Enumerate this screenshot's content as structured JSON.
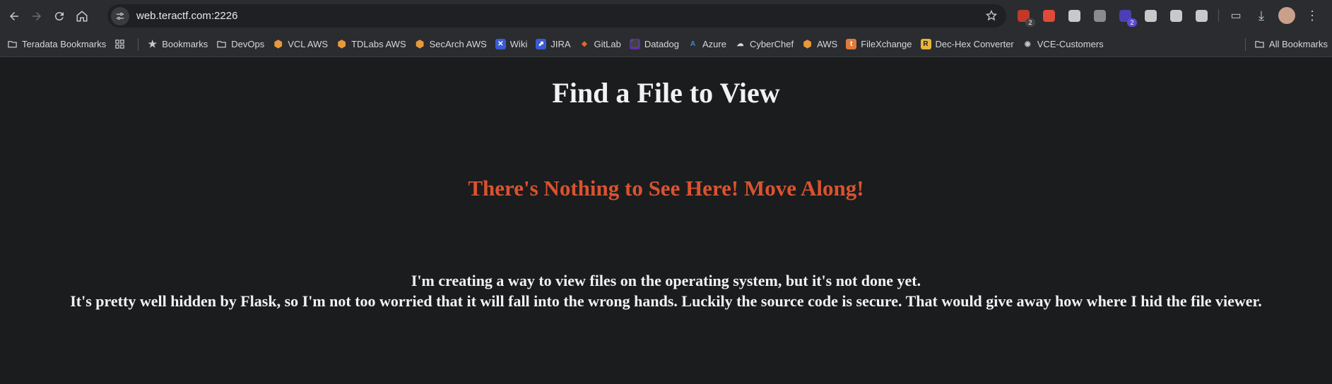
{
  "browser": {
    "url": "web.teractf.com:2226",
    "extensions": [
      {
        "name": "ext-badge-2-icon",
        "badge": "2",
        "color": "#c0392b"
      },
      {
        "name": "hand-stop-icon",
        "badge": "",
        "color": "#e04a3a"
      },
      {
        "name": "grammarly-icon",
        "badge": "",
        "color": "#c8c9cc"
      },
      {
        "name": "glasses-icon",
        "badge": "",
        "color": "#8a8b8f"
      },
      {
        "name": "hat-icon",
        "badge": "2",
        "color": "#4b3fb3"
      },
      {
        "name": "spy-icon",
        "badge": "",
        "color": "#c8c9cc"
      },
      {
        "name": "cloud-icon",
        "badge": "",
        "color": "#c8c9cc"
      },
      {
        "name": "puzzle-icon",
        "badge": "",
        "color": "#c8c9cc"
      }
    ]
  },
  "bookmarks": {
    "teradata": "Teradata Bookmarks",
    "items": [
      {
        "label": "Bookmarks",
        "icon": "star-icon"
      },
      {
        "label": "DevOps",
        "icon": "folder-icon"
      },
      {
        "label": "VCL AWS",
        "icon": "aws-cube-icon"
      },
      {
        "label": "TDLabs AWS",
        "icon": "aws-cube-icon"
      },
      {
        "label": "SecArch AWS",
        "icon": "aws-cube-icon"
      },
      {
        "label": "Wiki",
        "icon": "confluence-icon"
      },
      {
        "label": "JIRA",
        "icon": "jira-icon"
      },
      {
        "label": "GitLab",
        "icon": "gitlab-icon"
      },
      {
        "label": "Datadog",
        "icon": "datadog-icon"
      },
      {
        "label": "Azure",
        "icon": "azure-icon"
      },
      {
        "label": "CyberChef",
        "icon": "chef-hat-icon"
      },
      {
        "label": "AWS",
        "icon": "aws-cube-icon"
      },
      {
        "label": "FileXchange",
        "icon": "filexchange-icon"
      },
      {
        "label": "Dec-Hex Converter",
        "icon": "r-logo-icon"
      },
      {
        "label": "VCE-Customers",
        "icon": "globe-icon"
      }
    ],
    "all": "All Bookmarks"
  },
  "page": {
    "title": "Find a File to View",
    "subtitle": "There's Nothing to See Here! Move Along!",
    "line1": "I'm creating a way to view files on the operating system, but it's not done yet.",
    "line2": "It's pretty well hidden by Flask, so I'm not too worried that it will fall into the wrong hands. Luckily the source code is secure. That would give away how where I hid the file viewer."
  },
  "colors": {
    "background": "#1b1c1e",
    "subtitle": "#d9532f"
  }
}
